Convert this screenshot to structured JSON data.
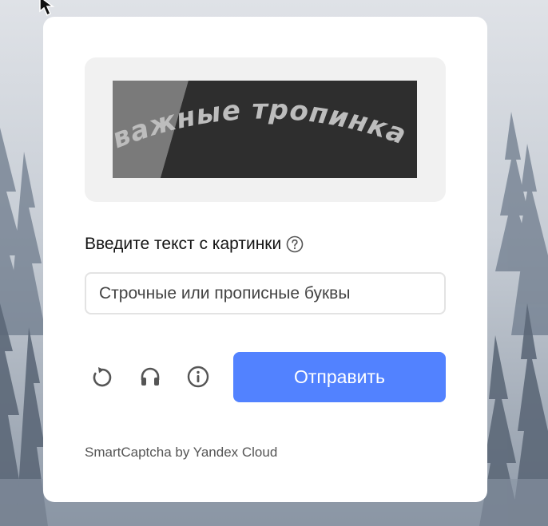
{
  "captcha": {
    "image_text": "важные тропинка",
    "prompt_label": "Введите текст с картинки",
    "input_placeholder": "Строчные или прописные буквы",
    "input_value": "",
    "submit_label": "Отправить",
    "footer_text": "SmartCaptcha by Yandex Cloud"
  },
  "icons": {
    "help": "question-circle-icon",
    "reload": "refresh-icon",
    "audio": "headphones-icon",
    "info": "info-icon"
  },
  "colors": {
    "accent": "#5282ff",
    "card": "#ffffff",
    "frame": "#f1f1f1"
  }
}
